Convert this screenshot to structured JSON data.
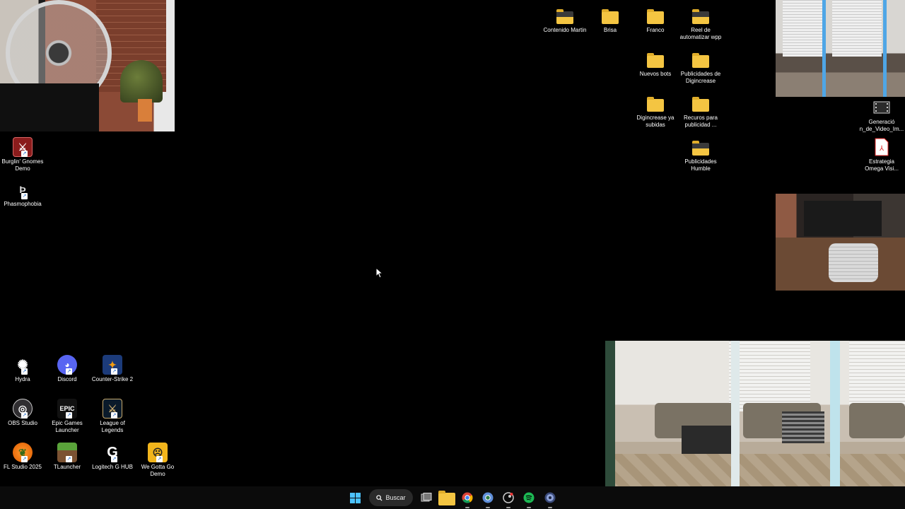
{
  "desktop": {
    "right_icons": [
      {
        "name": "folder-contenido-martin",
        "label": "Contenido Martin",
        "type": "folder-dark"
      },
      {
        "name": "folder-brisa",
        "label": "Brisa",
        "type": "folder"
      },
      {
        "name": "folder-franco",
        "label": "Franco",
        "type": "folder"
      },
      {
        "name": "folder-reel",
        "label": "Reel de automatizar wpp",
        "type": "folder-dark"
      },
      {
        "name": "folder-nuevos-bots",
        "label": "Nuevos bots",
        "type": "folder"
      },
      {
        "name": "folder-publicidades-digincrease",
        "label": "Publicidades de Digincrease",
        "type": "folder"
      },
      {
        "name": "folder-digincrease-subidas",
        "label": "Digincrease ya subidas",
        "type": "folder"
      },
      {
        "name": "folder-recursos-publicidad",
        "label": "Recuros para publicidad ...",
        "type": "folder"
      },
      {
        "name": "folder-publicidades-humble",
        "label": "Publicidades Humble",
        "type": "folder-dark"
      },
      {
        "name": "file-generacion-video",
        "label": "Generació n_de_Video_Im...",
        "type": "video"
      },
      {
        "name": "file-estrategia-omega",
        "label": "Estrategia Omega Visi...",
        "type": "pdf"
      }
    ],
    "left_top_icons": [
      {
        "name": "app-burglin-gnomes",
        "label": "Burglin' Gnomes Demo"
      },
      {
        "name": "app-phasmophobia",
        "label": "Phasmophobia"
      }
    ],
    "left_bottom_icons": [
      {
        "name": "app-hydra",
        "label": "Hydra"
      },
      {
        "name": "app-discord",
        "label": "Discord"
      },
      {
        "name": "app-counter-strike",
        "label": "Counter-Strike 2"
      },
      {
        "name": "app-obs-studio",
        "label": "OBS Studio"
      },
      {
        "name": "app-epic-games",
        "label": "Epic Games Launcher"
      },
      {
        "name": "app-league-of-legends",
        "label": "League of Legends"
      },
      {
        "name": "app-fl-studio",
        "label": "FL Studio 2025"
      },
      {
        "name": "app-tlauncher",
        "label": "TLauncher"
      },
      {
        "name": "app-logitech-g-hub",
        "label": "Logitech G HUB"
      },
      {
        "name": "app-we-gotta-go",
        "label": "We Gotta Go Demo"
      }
    ]
  },
  "icons_text": {
    "epic": "EPIC",
    "discord_glyph": "◕",
    "pdf_glyph": "⅄"
  },
  "taskbar": {
    "search_label": "Buscar",
    "apps": [
      "task-view",
      "file-explorer",
      "chrome",
      "chrome-dev",
      "steam",
      "spotify",
      "obs"
    ]
  },
  "colors": {
    "taskbar_bg": "#0b0b0b",
    "folder": "#f4c542",
    "windows_blue": "#4cc2ff",
    "spotify_green": "#1db954"
  }
}
